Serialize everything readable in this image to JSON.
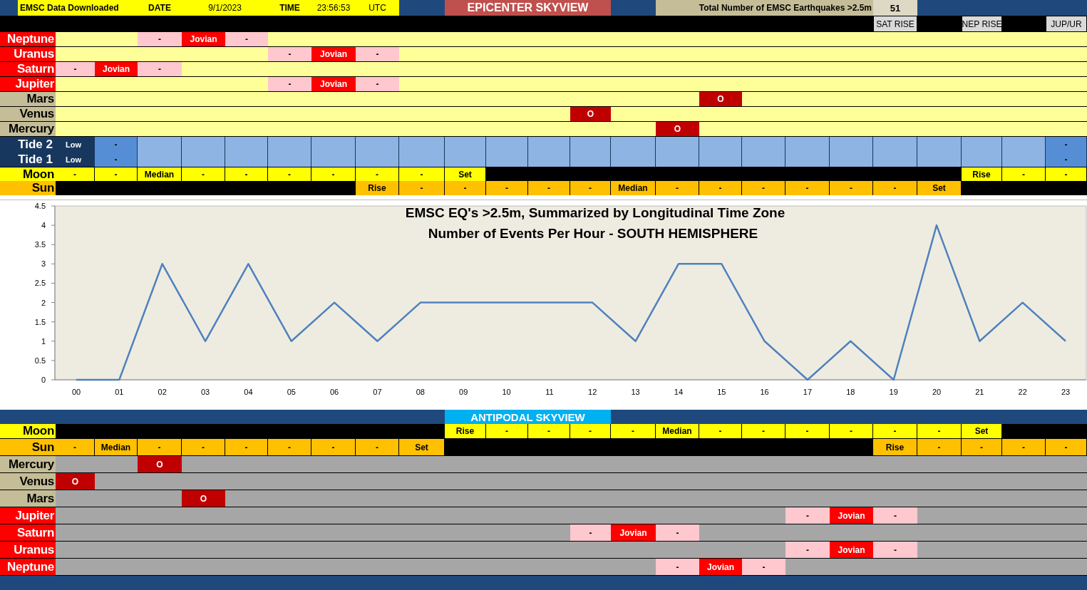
{
  "header": {
    "downloaded_label": "EMSC Data Downloaded",
    "date_label": "DATE",
    "date": "9/1/2023",
    "time_label": "TIME",
    "time": "23:56:53",
    "timezone": "UTC",
    "title": "EPICENTER SKYVIEW",
    "total_label": "Total Number of EMSC Earthquakes >2.5m",
    "total": "51"
  },
  "epicenter": {
    "markers": {
      "cells": [
        {
          "kind": "dark"
        },
        {
          "kind": "dark"
        },
        {
          "kind": "dark"
        },
        {
          "kind": "dark"
        },
        {
          "kind": "dark"
        },
        {
          "kind": "dark"
        },
        {
          "kind": "dark"
        },
        {
          "kind": "dark"
        },
        {
          "kind": "dark"
        },
        {
          "kind": "dark"
        },
        {
          "kind": "dark"
        },
        {
          "kind": "dark"
        },
        {
          "kind": "dark"
        },
        {
          "kind": "dark"
        },
        {
          "kind": "dark"
        },
        {
          "kind": "dark"
        },
        {
          "kind": "dark"
        },
        {
          "kind": "dark"
        },
        {
          "kind": "dark"
        },
        {
          "kind": "tag",
          "text": "SAT RISE"
        },
        {
          "kind": "dark"
        },
        {
          "kind": "tag",
          "text": "NEP RISE"
        },
        {
          "kind": "dark"
        },
        {
          "kind": "tag",
          "text": "JUP/UR"
        }
      ]
    },
    "planets": [
      {
        "label": "Neptune",
        "kind": "outer",
        "cells": [
          {
            "kind": "blank"
          },
          {
            "kind": "blank"
          },
          {
            "kind": "minus",
            "text": "-"
          },
          {
            "kind": "jovian",
            "text": "Jovian"
          },
          {
            "kind": "minus",
            "text": "-"
          },
          {
            "kind": "blank"
          },
          {
            "kind": "blank"
          },
          {
            "kind": "blank"
          },
          {
            "kind": "blank"
          },
          {
            "kind": "blank"
          },
          {
            "kind": "blank"
          },
          {
            "kind": "blank"
          },
          {
            "kind": "blank"
          },
          {
            "kind": "blank"
          },
          {
            "kind": "blank"
          },
          {
            "kind": "blank"
          },
          {
            "kind": "blank"
          },
          {
            "kind": "blank"
          },
          {
            "kind": "blank"
          },
          {
            "kind": "blank"
          },
          {
            "kind": "blank"
          },
          {
            "kind": "blank"
          },
          {
            "kind": "blank"
          },
          {
            "kind": "blank"
          }
        ]
      },
      {
        "label": "Uranus",
        "kind": "outer",
        "cells": [
          {
            "kind": "blank"
          },
          {
            "kind": "blank"
          },
          {
            "kind": "blank"
          },
          {
            "kind": "blank"
          },
          {
            "kind": "blank"
          },
          {
            "kind": "minus",
            "text": "-"
          },
          {
            "kind": "jovian",
            "text": "Jovian"
          },
          {
            "kind": "minus",
            "text": "-"
          },
          {
            "kind": "blank"
          },
          {
            "kind": "blank"
          },
          {
            "kind": "blank"
          },
          {
            "kind": "blank"
          },
          {
            "kind": "blank"
          },
          {
            "kind": "blank"
          },
          {
            "kind": "blank"
          },
          {
            "kind": "blank"
          },
          {
            "kind": "blank"
          },
          {
            "kind": "blank"
          },
          {
            "kind": "blank"
          },
          {
            "kind": "blank"
          },
          {
            "kind": "blank"
          },
          {
            "kind": "blank"
          },
          {
            "kind": "blank"
          },
          {
            "kind": "blank"
          }
        ]
      },
      {
        "label": "Saturn",
        "kind": "outer",
        "cells": [
          {
            "kind": "minus",
            "text": "-"
          },
          {
            "kind": "jovian",
            "text": "Jovian"
          },
          {
            "kind": "minus",
            "text": "-"
          },
          {
            "kind": "blank"
          },
          {
            "kind": "blank"
          },
          {
            "kind": "blank"
          },
          {
            "kind": "blank"
          },
          {
            "kind": "blank"
          },
          {
            "kind": "blank"
          },
          {
            "kind": "blank"
          },
          {
            "kind": "blank"
          },
          {
            "kind": "blank"
          },
          {
            "kind": "blank"
          },
          {
            "kind": "blank"
          },
          {
            "kind": "blank"
          },
          {
            "kind": "blank"
          },
          {
            "kind": "blank"
          },
          {
            "kind": "blank"
          },
          {
            "kind": "blank"
          },
          {
            "kind": "blank"
          },
          {
            "kind": "blank"
          },
          {
            "kind": "blank"
          },
          {
            "kind": "blank"
          },
          {
            "kind": "blank"
          }
        ]
      },
      {
        "label": "Jupiter",
        "kind": "outer",
        "cells": [
          {
            "kind": "blank"
          },
          {
            "kind": "blank"
          },
          {
            "kind": "blank"
          },
          {
            "kind": "blank"
          },
          {
            "kind": "blank"
          },
          {
            "kind": "minus",
            "text": "-"
          },
          {
            "kind": "jovian",
            "text": "Jovian"
          },
          {
            "kind": "minus",
            "text": "-"
          },
          {
            "kind": "blank"
          },
          {
            "kind": "blank"
          },
          {
            "kind": "blank"
          },
          {
            "kind": "blank"
          },
          {
            "kind": "blank"
          },
          {
            "kind": "blank"
          },
          {
            "kind": "blank"
          },
          {
            "kind": "blank"
          },
          {
            "kind": "blank"
          },
          {
            "kind": "blank"
          },
          {
            "kind": "blank"
          },
          {
            "kind": "blank"
          },
          {
            "kind": "blank"
          },
          {
            "kind": "blank"
          },
          {
            "kind": "blank"
          },
          {
            "kind": "blank"
          }
        ]
      },
      {
        "label": "Mars",
        "kind": "inner",
        "cells": [
          {
            "kind": "blank"
          },
          {
            "kind": "blank"
          },
          {
            "kind": "blank"
          },
          {
            "kind": "blank"
          },
          {
            "kind": "blank"
          },
          {
            "kind": "blank"
          },
          {
            "kind": "blank"
          },
          {
            "kind": "blank"
          },
          {
            "kind": "blank"
          },
          {
            "kind": "blank"
          },
          {
            "kind": "blank"
          },
          {
            "kind": "blank"
          },
          {
            "kind": "blank"
          },
          {
            "kind": "blank"
          },
          {
            "kind": "blank"
          },
          {
            "kind": "conj",
            "text": "O"
          },
          {
            "kind": "blank"
          },
          {
            "kind": "blank"
          },
          {
            "kind": "blank"
          },
          {
            "kind": "blank"
          },
          {
            "kind": "blank"
          },
          {
            "kind": "blank"
          },
          {
            "kind": "blank"
          },
          {
            "kind": "blank"
          }
        ]
      },
      {
        "label": "Venus",
        "kind": "inner",
        "cells": [
          {
            "kind": "blank"
          },
          {
            "kind": "blank"
          },
          {
            "kind": "blank"
          },
          {
            "kind": "blank"
          },
          {
            "kind": "blank"
          },
          {
            "kind": "blank"
          },
          {
            "kind": "blank"
          },
          {
            "kind": "blank"
          },
          {
            "kind": "blank"
          },
          {
            "kind": "blank"
          },
          {
            "kind": "blank"
          },
          {
            "kind": "blank"
          },
          {
            "kind": "conj",
            "text": "O"
          },
          {
            "kind": "blank"
          },
          {
            "kind": "blank"
          },
          {
            "kind": "blank"
          },
          {
            "kind": "blank"
          },
          {
            "kind": "blank"
          },
          {
            "kind": "blank"
          },
          {
            "kind": "blank"
          },
          {
            "kind": "blank"
          },
          {
            "kind": "blank"
          },
          {
            "kind": "blank"
          },
          {
            "kind": "blank"
          }
        ]
      },
      {
        "label": "Mercury",
        "kind": "inner",
        "cells": [
          {
            "kind": "blank"
          },
          {
            "kind": "blank"
          },
          {
            "kind": "blank"
          },
          {
            "kind": "blank"
          },
          {
            "kind": "blank"
          },
          {
            "kind": "blank"
          },
          {
            "kind": "blank"
          },
          {
            "kind": "blank"
          },
          {
            "kind": "blank"
          },
          {
            "kind": "blank"
          },
          {
            "kind": "blank"
          },
          {
            "kind": "blank"
          },
          {
            "kind": "blank"
          },
          {
            "kind": "blank"
          },
          {
            "kind": "conj",
            "text": "O"
          },
          {
            "kind": "blank"
          },
          {
            "kind": "blank"
          },
          {
            "kind": "blank"
          },
          {
            "kind": "blank"
          },
          {
            "kind": "blank"
          },
          {
            "kind": "blank"
          },
          {
            "kind": "blank"
          },
          {
            "kind": "blank"
          },
          {
            "kind": "blank"
          }
        ]
      }
    ],
    "tides": {
      "labels": [
        "Tide 2",
        "Tide 1"
      ],
      "columns": [
        {
          "kind": "low",
          "texts": [
            "Low",
            "Low"
          ]
        },
        {
          "kind": "mid",
          "texts": [
            "-",
            "-"
          ]
        },
        {
          "kind": "plain"
        },
        {
          "kind": "plain"
        },
        {
          "kind": "plain"
        },
        {
          "kind": "plain"
        },
        {
          "kind": "plain"
        },
        {
          "kind": "plain"
        },
        {
          "kind": "plain"
        },
        {
          "kind": "plain"
        },
        {
          "kind": "plain"
        },
        {
          "kind": "plain"
        },
        {
          "kind": "plain"
        },
        {
          "kind": "plain"
        },
        {
          "kind": "plain"
        },
        {
          "kind": "plain"
        },
        {
          "kind": "plain"
        },
        {
          "kind": "plain"
        },
        {
          "kind": "plain"
        },
        {
          "kind": "plain"
        },
        {
          "kind": "plain"
        },
        {
          "kind": "plain"
        },
        {
          "kind": "plain"
        },
        {
          "kind": "mid",
          "texts": [
            "-",
            "-"
          ]
        }
      ]
    },
    "luminaries": [
      {
        "label": "Moon",
        "kind": "moon",
        "cells": [
          {
            "kind": "moon",
            "text": "-"
          },
          {
            "kind": "moon",
            "text": "-"
          },
          {
            "kind": "moon",
            "text": "Median"
          },
          {
            "kind": "moon",
            "text": "-"
          },
          {
            "kind": "moon",
            "text": "-"
          },
          {
            "kind": "moon",
            "text": "-"
          },
          {
            "kind": "moon",
            "text": "-"
          },
          {
            "kind": "moon",
            "text": "-"
          },
          {
            "kind": "moon",
            "text": "-"
          },
          {
            "kind": "moon",
            "text": "Set"
          },
          {
            "kind": "dark"
          },
          {
            "kind": "dark"
          },
          {
            "kind": "dark"
          },
          {
            "kind": "dark"
          },
          {
            "kind": "dark"
          },
          {
            "kind": "dark"
          },
          {
            "kind": "dark"
          },
          {
            "kind": "dark"
          },
          {
            "kind": "dark"
          },
          {
            "kind": "dark"
          },
          {
            "kind": "dark"
          },
          {
            "kind": "moon",
            "text": "Rise"
          },
          {
            "kind": "moon",
            "text": "-"
          },
          {
            "kind": "moon",
            "text": "-"
          }
        ]
      },
      {
        "label": "Sun",
        "kind": "sun",
        "cells": [
          {
            "kind": "dark"
          },
          {
            "kind": "dark"
          },
          {
            "kind": "dark"
          },
          {
            "kind": "dark"
          },
          {
            "kind": "dark"
          },
          {
            "kind": "dark"
          },
          {
            "kind": "dark"
          },
          {
            "kind": "sun",
            "text": "Rise"
          },
          {
            "kind": "sun",
            "text": "-"
          },
          {
            "kind": "sun",
            "text": "-"
          },
          {
            "kind": "sun",
            "text": "-"
          },
          {
            "kind": "sun",
            "text": "-"
          },
          {
            "kind": "sun",
            "text": "-"
          },
          {
            "kind": "sun",
            "text": "Median"
          },
          {
            "kind": "sun",
            "text": "-"
          },
          {
            "kind": "sun",
            "text": "-"
          },
          {
            "kind": "sun",
            "text": "-"
          },
          {
            "kind": "sun",
            "text": "-"
          },
          {
            "kind": "sun",
            "text": "-"
          },
          {
            "kind": "sun",
            "text": "-"
          },
          {
            "kind": "sun",
            "text": "Set"
          },
          {
            "kind": "dark"
          },
          {
            "kind": "dark"
          },
          {
            "kind": "dark"
          }
        ]
      }
    ]
  },
  "chart": {
    "subtitle": "Number of Events Per Hour - SOUTH HEMISPHERE",
    "chart_data": {
      "type": "line",
      "title": "EMSC EQ's >2.5m, Summarized by Longitudinal Time Zone",
      "categories": [
        "00",
        "01",
        "02",
        "03",
        "04",
        "05",
        "06",
        "07",
        "08",
        "09",
        "10",
        "11",
        "12",
        "13",
        "14",
        "15",
        "16",
        "17",
        "18",
        "19",
        "20",
        "21",
        "22",
        "23"
      ],
      "series": [
        {
          "color": "#4f81bd",
          "values": [
            0,
            0,
            3,
            1,
            3,
            1,
            2,
            1,
            2,
            2,
            2,
            2,
            2,
            1,
            3,
            3,
            1,
            0,
            1,
            0,
            4,
            1,
            2,
            1
          ]
        }
      ],
      "ylim": [
        0,
        4.5
      ],
      "yticks": [
        0,
        0.5,
        1,
        1.5,
        2,
        2.5,
        3,
        3.5,
        4,
        4.5
      ]
    }
  },
  "antipodal": {
    "title": "ANTIPODAL SKYVIEW",
    "luminaries": [
      {
        "label": "Moon",
        "kind": "moon",
        "cells": [
          {
            "kind": "dark"
          },
          {
            "kind": "dark"
          },
          {
            "kind": "dark"
          },
          {
            "kind": "dark"
          },
          {
            "kind": "dark"
          },
          {
            "kind": "dark"
          },
          {
            "kind": "dark"
          },
          {
            "kind": "dark"
          },
          {
            "kind": "dark"
          },
          {
            "kind": "moon",
            "text": "Rise"
          },
          {
            "kind": "moon",
            "text": "-"
          },
          {
            "kind": "moon",
            "text": "-"
          },
          {
            "kind": "moon",
            "text": "-"
          },
          {
            "kind": "moon",
            "text": "-"
          },
          {
            "kind": "moon",
            "text": "Median"
          },
          {
            "kind": "moon",
            "text": "-"
          },
          {
            "kind": "moon",
            "text": "-"
          },
          {
            "kind": "moon",
            "text": "-"
          },
          {
            "kind": "moon",
            "text": "-"
          },
          {
            "kind": "moon",
            "text": "-"
          },
          {
            "kind": "moon",
            "text": "-"
          },
          {
            "kind": "moon",
            "text": "Set"
          },
          {
            "kind": "dark"
          },
          {
            "kind": "dark"
          }
        ]
      },
      {
        "label": "Sun",
        "kind": "sun",
        "cells": [
          {
            "kind": "sun",
            "text": "-"
          },
          {
            "kind": "sun",
            "text": "Median"
          },
          {
            "kind": "sun",
            "text": "-"
          },
          {
            "kind": "sun",
            "text": "-"
          },
          {
            "kind": "sun",
            "text": "-"
          },
          {
            "kind": "sun",
            "text": "-"
          },
          {
            "kind": "sun",
            "text": "-"
          },
          {
            "kind": "sun",
            "text": "-"
          },
          {
            "kind": "sun",
            "text": "Set"
          },
          {
            "kind": "dark"
          },
          {
            "kind": "dark"
          },
          {
            "kind": "dark"
          },
          {
            "kind": "dark"
          },
          {
            "kind": "dark"
          },
          {
            "kind": "dark"
          },
          {
            "kind": "dark"
          },
          {
            "kind": "dark"
          },
          {
            "kind": "dark"
          },
          {
            "kind": "dark"
          },
          {
            "kind": "sun",
            "text": "Rise"
          },
          {
            "kind": "sun",
            "text": "-"
          },
          {
            "kind": "sun",
            "text": "-"
          },
          {
            "kind": "sun",
            "text": "-"
          },
          {
            "kind": "sun",
            "text": "-"
          }
        ]
      }
    ],
    "planets": [
      {
        "label": "Mercury",
        "kind": "inner",
        "cells": [
          {
            "kind": "blank"
          },
          {
            "kind": "blank"
          },
          {
            "kind": "conj",
            "text": "O"
          },
          {
            "kind": "blank"
          },
          {
            "kind": "blank"
          },
          {
            "kind": "blank"
          },
          {
            "kind": "blank"
          },
          {
            "kind": "blank"
          },
          {
            "kind": "blank"
          },
          {
            "kind": "blank"
          },
          {
            "kind": "blank"
          },
          {
            "kind": "blank"
          },
          {
            "kind": "blank"
          },
          {
            "kind": "blank"
          },
          {
            "kind": "blank"
          },
          {
            "kind": "blank"
          },
          {
            "kind": "blank"
          },
          {
            "kind": "blank"
          },
          {
            "kind": "blank"
          },
          {
            "kind": "blank"
          },
          {
            "kind": "blank"
          },
          {
            "kind": "blank"
          },
          {
            "kind": "blank"
          },
          {
            "kind": "blank"
          }
        ]
      },
      {
        "label": "Venus",
        "kind": "inner",
        "cells": [
          {
            "kind": "conj",
            "text": "O"
          },
          {
            "kind": "blank"
          },
          {
            "kind": "blank"
          },
          {
            "kind": "blank"
          },
          {
            "kind": "blank"
          },
          {
            "kind": "blank"
          },
          {
            "kind": "blank"
          },
          {
            "kind": "blank"
          },
          {
            "kind": "blank"
          },
          {
            "kind": "blank"
          },
          {
            "kind": "blank"
          },
          {
            "kind": "blank"
          },
          {
            "kind": "blank"
          },
          {
            "kind": "blank"
          },
          {
            "kind": "blank"
          },
          {
            "kind": "blank"
          },
          {
            "kind": "blank"
          },
          {
            "kind": "blank"
          },
          {
            "kind": "blank"
          },
          {
            "kind": "blank"
          },
          {
            "kind": "blank"
          },
          {
            "kind": "blank"
          },
          {
            "kind": "blank"
          },
          {
            "kind": "blank"
          }
        ]
      },
      {
        "label": "Mars",
        "kind": "inner",
        "cells": [
          {
            "kind": "blank"
          },
          {
            "kind": "blank"
          },
          {
            "kind": "blank"
          },
          {
            "kind": "conj",
            "text": "O"
          },
          {
            "kind": "blank"
          },
          {
            "kind": "blank"
          },
          {
            "kind": "blank"
          },
          {
            "kind": "blank"
          },
          {
            "kind": "blank"
          },
          {
            "kind": "blank"
          },
          {
            "kind": "blank"
          },
          {
            "kind": "blank"
          },
          {
            "kind": "blank"
          },
          {
            "kind": "blank"
          },
          {
            "kind": "blank"
          },
          {
            "kind": "blank"
          },
          {
            "kind": "blank"
          },
          {
            "kind": "blank"
          },
          {
            "kind": "blank"
          },
          {
            "kind": "blank"
          },
          {
            "kind": "blank"
          },
          {
            "kind": "blank"
          },
          {
            "kind": "blank"
          },
          {
            "kind": "blank"
          }
        ]
      },
      {
        "label": "Jupiter",
        "kind": "outer",
        "cells": [
          {
            "kind": "blank"
          },
          {
            "kind": "blank"
          },
          {
            "kind": "blank"
          },
          {
            "kind": "blank"
          },
          {
            "kind": "blank"
          },
          {
            "kind": "blank"
          },
          {
            "kind": "blank"
          },
          {
            "kind": "blank"
          },
          {
            "kind": "blank"
          },
          {
            "kind": "blank"
          },
          {
            "kind": "blank"
          },
          {
            "kind": "blank"
          },
          {
            "kind": "blank"
          },
          {
            "kind": "blank"
          },
          {
            "kind": "blank"
          },
          {
            "kind": "blank"
          },
          {
            "kind": "blank"
          },
          {
            "kind": "minus",
            "text": "-"
          },
          {
            "kind": "jovian",
            "text": "Jovian"
          },
          {
            "kind": "minus",
            "text": "-"
          },
          {
            "kind": "blank"
          },
          {
            "kind": "blank"
          },
          {
            "kind": "blank"
          },
          {
            "kind": "blank"
          }
        ]
      },
      {
        "label": "Saturn",
        "kind": "outer",
        "cells": [
          {
            "kind": "blank"
          },
          {
            "kind": "blank"
          },
          {
            "kind": "blank"
          },
          {
            "kind": "blank"
          },
          {
            "kind": "blank"
          },
          {
            "kind": "blank"
          },
          {
            "kind": "blank"
          },
          {
            "kind": "blank"
          },
          {
            "kind": "blank"
          },
          {
            "kind": "blank"
          },
          {
            "kind": "blank"
          },
          {
            "kind": "blank"
          },
          {
            "kind": "minus",
            "text": "-"
          },
          {
            "kind": "jovian",
            "text": "Jovian"
          },
          {
            "kind": "minus",
            "text": "-"
          },
          {
            "kind": "blank"
          },
          {
            "kind": "blank"
          },
          {
            "kind": "blank"
          },
          {
            "kind": "blank"
          },
          {
            "kind": "blank"
          },
          {
            "kind": "blank"
          },
          {
            "kind": "blank"
          },
          {
            "kind": "blank"
          },
          {
            "kind": "blank"
          }
        ]
      },
      {
        "label": "Uranus",
        "kind": "outer",
        "cells": [
          {
            "kind": "blank"
          },
          {
            "kind": "blank"
          },
          {
            "kind": "blank"
          },
          {
            "kind": "blank"
          },
          {
            "kind": "blank"
          },
          {
            "kind": "blank"
          },
          {
            "kind": "blank"
          },
          {
            "kind": "blank"
          },
          {
            "kind": "blank"
          },
          {
            "kind": "blank"
          },
          {
            "kind": "blank"
          },
          {
            "kind": "blank"
          },
          {
            "kind": "blank"
          },
          {
            "kind": "blank"
          },
          {
            "kind": "blank"
          },
          {
            "kind": "blank"
          },
          {
            "kind": "blank"
          },
          {
            "kind": "minus",
            "text": "-"
          },
          {
            "kind": "jovian",
            "text": "Jovian"
          },
          {
            "kind": "minus",
            "text": "-"
          },
          {
            "kind": "blank"
          },
          {
            "kind": "blank"
          },
          {
            "kind": "blank"
          },
          {
            "kind": "blank"
          }
        ]
      },
      {
        "label": "Neptune",
        "kind": "outer",
        "cells": [
          {
            "kind": "blank"
          },
          {
            "kind": "blank"
          },
          {
            "kind": "blank"
          },
          {
            "kind": "blank"
          },
          {
            "kind": "blank"
          },
          {
            "kind": "blank"
          },
          {
            "kind": "blank"
          },
          {
            "kind": "blank"
          },
          {
            "kind": "blank"
          },
          {
            "kind": "blank"
          },
          {
            "kind": "blank"
          },
          {
            "kind": "blank"
          },
          {
            "kind": "blank"
          },
          {
            "kind": "blank"
          },
          {
            "kind": "minus",
            "text": "-"
          },
          {
            "kind": "jovian",
            "text": "Jovian"
          },
          {
            "kind": "minus",
            "text": "-"
          },
          {
            "kind": "blank"
          },
          {
            "kind": "blank"
          },
          {
            "kind": "blank"
          },
          {
            "kind": "blank"
          },
          {
            "kind": "blank"
          },
          {
            "kind": "blank"
          },
          {
            "kind": "blank"
          }
        ]
      }
    ]
  }
}
